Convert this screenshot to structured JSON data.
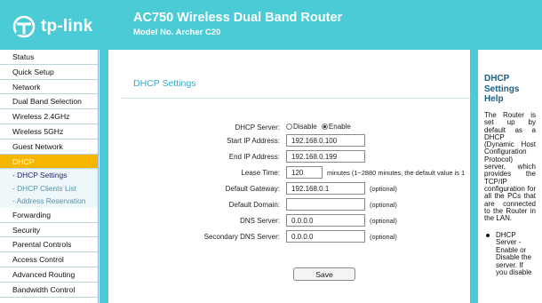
{
  "header": {
    "brand": "tp-link",
    "title": "AC750 Wireless Dual Band Router",
    "model": "Model No. Archer C20",
    "brand_color": "#4acbd6"
  },
  "menu": {
    "items": [
      {
        "label": "Status"
      },
      {
        "label": "Quick Setup"
      },
      {
        "label": "Network"
      },
      {
        "label": "Dual Band Selection"
      },
      {
        "label": "Wireless 2.4GHz"
      },
      {
        "label": "Wireless 5GHz"
      },
      {
        "label": "Guest Network"
      },
      {
        "label": "DHCP"
      },
      {
        "label": "- DHCP Settings"
      },
      {
        "label": "- DHCP Clients List"
      },
      {
        "label": "- Address Reservation"
      },
      {
        "label": "Forwarding"
      },
      {
        "label": "Security"
      },
      {
        "label": "Parental Controls"
      },
      {
        "label": "Access Control"
      },
      {
        "label": "Advanced Routing"
      },
      {
        "label": "Bandwidth Control"
      }
    ],
    "active_color": "#f7b600"
  },
  "main": {
    "section_title": "DHCP Settings",
    "dhcp_server": {
      "label": "DHCP Server:",
      "option_disable": "Disable",
      "option_enable": "Enable",
      "selected": "Enable"
    },
    "start_ip": {
      "label": "Start IP Address:",
      "value": "192.168.0.100"
    },
    "end_ip": {
      "label": "End IP Address:",
      "value": "192.168.0.199"
    },
    "lease_time": {
      "label": "Lease Time:",
      "value": "120",
      "hint": "minutes (1~2880 minutes, the default value is 1"
    },
    "default_gateway": {
      "label": "Default Gateway:",
      "value": "192.168.0.1",
      "hint": "(optional)"
    },
    "default_domain": {
      "label": "Default Domain:",
      "value": "",
      "hint": "(optional)"
    },
    "dns_server": {
      "label": "DNS Server:",
      "value": "0.0.0.0",
      "hint": "(optional)"
    },
    "secondary_dns": {
      "label": "Secondary DNS Server:",
      "value": "0.0.0.0",
      "hint": "(optional)"
    },
    "save_label": "Save"
  },
  "help": {
    "title": "DHCP Settings Help",
    "body": "The Router is set up by default as a DHCP (Dynamic Host Configuration Protocol) server, which provides the TCP/IP configuration for all the PCs that are connected to the Router in the LAN.",
    "bullet": "DHCP Server - Enable or Disable the server. If you disable"
  }
}
